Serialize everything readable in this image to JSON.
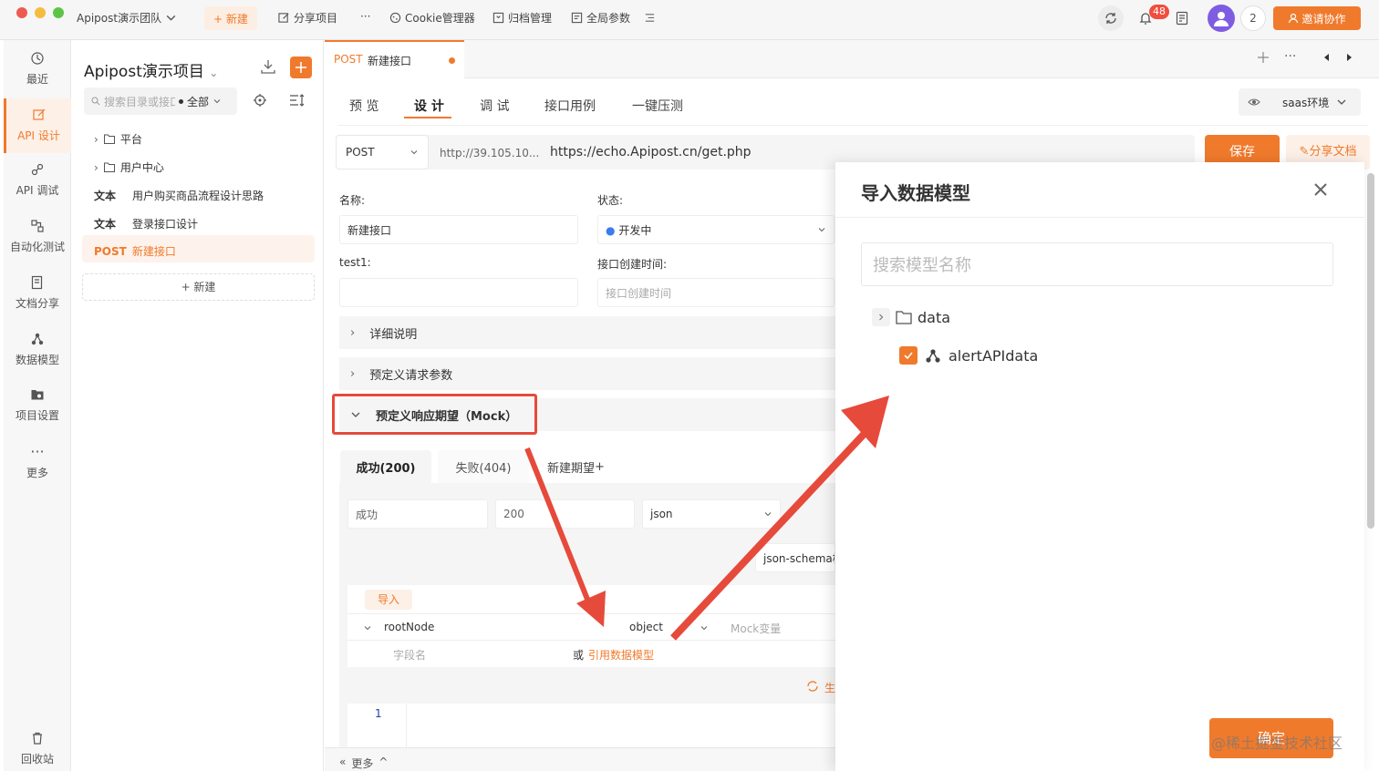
{
  "colors": {
    "accent": "#f07a2c",
    "annotation_red": "#e64a3b",
    "notification_red": "#f04e3e",
    "avatar": "#7e5de3"
  },
  "topbar": {
    "team": "Apipost演示团队",
    "new_label": "+ 新建",
    "share_project": "分享项目",
    "more": "···",
    "cookie_manager": "Cookie管理器",
    "archive_manager": "归档管理",
    "global_params": "全局参数",
    "notification_count": "48",
    "member_count": "2",
    "invite_label": "邀请协作"
  },
  "rail": {
    "recent": "最近",
    "api_design": "API 设计",
    "api_debug": "API 调试",
    "automation": "自动化测试",
    "doc_share": "文档分享",
    "data_model": "数据模型",
    "project_settings": "项目设置",
    "more": "更多",
    "recycle": "回收站"
  },
  "tree": {
    "project_title": "Apipost演示项目",
    "search_placeholder": "搜索目录或接口",
    "filter": "全部",
    "items": [
      {
        "type": "folder",
        "label": "平台"
      },
      {
        "type": "folder",
        "label": "用户中心"
      },
      {
        "tag": "文本",
        "label": "用户购买商品流程设计思路"
      },
      {
        "tag": "文本",
        "label": "登录接口设计"
      },
      {
        "tag": "POST",
        "label": "新建接口"
      }
    ],
    "new_label": "+ 新建"
  },
  "doc_tab": {
    "method": "POST",
    "name": "新建接口"
  },
  "sub_tabs": [
    "预 览",
    "设 计",
    "调 试",
    "接口用例",
    "一键压测"
  ],
  "env": "saas环境",
  "request": {
    "method": "POST",
    "base_url": "http://39.105.10...",
    "path": "https://echo.Apipost.cn/get.php",
    "save": "保存",
    "share_doc": "分享文档"
  },
  "form": {
    "name_label": "名称:",
    "name_value": "新建接口",
    "status_label": "状态:",
    "status_value": "开发中",
    "test1_label": "test1:",
    "created_label": "接口创建时间:",
    "created_placeholder": "接口创建时间"
  },
  "sections": {
    "detail": "详细说明",
    "request_params": "预定义请求参数",
    "mock": "预定义响应期望（Mock）"
  },
  "response": {
    "tab_success": "成功(200)",
    "tab_fail": "失败(404)",
    "new_expect": "新建期望",
    "name": "成功",
    "code": "200",
    "format": "json",
    "schema_btn": "json-schema模",
    "import": "导入",
    "root_node": "rootNode",
    "type": "object",
    "mock_var": "Mock变量",
    "field_name": "字段名",
    "or": "或",
    "ref_model": "引用数据模型",
    "gen_label": "生",
    "line_number": "1",
    "more": "更多"
  },
  "modal": {
    "title": "导入数据模型",
    "search_placeholder": "搜索模型名称",
    "folder": "data",
    "model": "alertAPIdata",
    "confirm": "确定",
    "watermark": "@稀土掘金技术社区"
  }
}
